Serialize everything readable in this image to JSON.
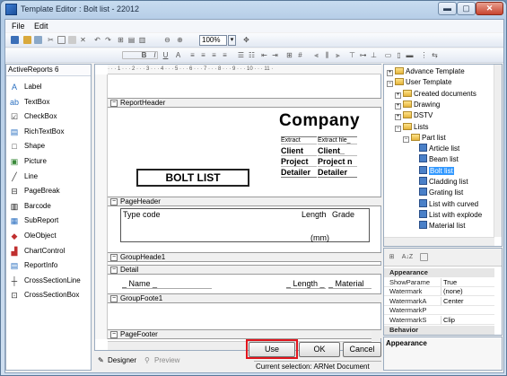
{
  "window": {
    "title": "Template Editor : Bolt list - 22012",
    "min_glyph": "▬",
    "max_glyph": "▢",
    "close_glyph": "✕"
  },
  "menu": {
    "file": "File",
    "edit": "Edit"
  },
  "toolbar": {
    "zoom_value": "100%"
  },
  "toolbox": {
    "header": "ActiveReports 6",
    "items": [
      {
        "label": "Label",
        "icon": "label-icon",
        "glyph": "A",
        "color": "#2a6fc0"
      },
      {
        "label": "TextBox",
        "icon": "textbox-icon",
        "glyph": "ab",
        "color": "#2a6fc0"
      },
      {
        "label": "CheckBox",
        "icon": "checkbox-icon",
        "glyph": "☑",
        "color": "#333333"
      },
      {
        "label": "RichTextBox",
        "icon": "richtextbox-icon",
        "glyph": "▤",
        "color": "#2a6fc0"
      },
      {
        "label": "Shape",
        "icon": "shape-icon",
        "glyph": "□",
        "color": "#333333"
      },
      {
        "label": "Picture",
        "icon": "picture-icon",
        "glyph": "▣",
        "color": "#3a8a3a"
      },
      {
        "label": "Line",
        "icon": "line-icon",
        "glyph": "╱",
        "color": "#333333"
      },
      {
        "label": "PageBreak",
        "icon": "pagebreak-icon",
        "glyph": "⊟",
        "color": "#333333"
      },
      {
        "label": "Barcode",
        "icon": "barcode-icon",
        "glyph": "▥",
        "color": "#000000"
      },
      {
        "label": "SubReport",
        "icon": "subreport-icon",
        "glyph": "▦",
        "color": "#2a6fc0"
      },
      {
        "label": "OleObject",
        "icon": "oleobject-icon",
        "glyph": "◆",
        "color": "#c03030"
      },
      {
        "label": "ChartControl",
        "icon": "chartcontrol-icon",
        "glyph": "▟",
        "color": "#c03030"
      },
      {
        "label": "ReportInfo",
        "icon": "reportinfo-icon",
        "glyph": "▤",
        "color": "#2a6fc0"
      },
      {
        "label": "CrossSectionLine",
        "icon": "crosssectionline-icon",
        "glyph": "┼",
        "color": "#333333"
      },
      {
        "label": "CrossSectionBox",
        "icon": "crosssectionbox-icon",
        "glyph": "⊡",
        "color": "#333333"
      }
    ]
  },
  "designer": {
    "ruler_text": "· · · 1 · · · 2 · · · 3 · · · 4 · · · 5 · · · 6 · · · 7 · · · 8 · · · 9 · · · 10 · · · 11 ·",
    "bands": {
      "report_header": "ReportHeader",
      "page_header": "PageHeader",
      "group_header": "GroupHeade1",
      "detail": "Detail",
      "group_footer": "GroupFoote1",
      "page_footer": "PageFooter"
    },
    "company": "Company",
    "extract_label": "Extract",
    "extract_value": "Extract file_",
    "client_label": "Client",
    "client_value": "Client_",
    "project_label": "Project",
    "project_value": "Project n",
    "detailer_label": "Detailer",
    "detailer_value": "Detailer",
    "title": "BOLT LIST",
    "col_type_code": "Type code",
    "col_length": "Length",
    "col_grade": "Grade",
    "unit_mm": "(mm)",
    "field_name": "_ Name _",
    "field_length": "_ Length _",
    "field_material": "_ Material"
  },
  "tabs": {
    "designer": "Designer",
    "preview": "Preview"
  },
  "buttons": {
    "use": "Use",
    "ok": "OK",
    "cancel": "Cancel"
  },
  "status": {
    "text": "Current selection: ARNet Document"
  },
  "tree": {
    "items": [
      {
        "label": "Advance Template",
        "kind": "folder",
        "level": 0,
        "expander": "+"
      },
      {
        "label": "User Template",
        "kind": "folder",
        "level": 0,
        "expander": "−"
      },
      {
        "label": "Created documents",
        "kind": "folder",
        "level": 1,
        "expander": "+"
      },
      {
        "label": "Drawing",
        "kind": "folder",
        "level": 1,
        "expander": "+"
      },
      {
        "label": "DSTV",
        "kind": "folder",
        "level": 1,
        "expander": "+"
      },
      {
        "label": "Lists",
        "kind": "folder",
        "level": 1,
        "expander": "−"
      },
      {
        "label": "Part list",
        "kind": "folder",
        "level": 2,
        "expander": "−"
      },
      {
        "label": "Article list",
        "kind": "report",
        "level": 3
      },
      {
        "label": "Beam list",
        "kind": "report",
        "level": 3
      },
      {
        "label": "Bolt list",
        "kind": "report",
        "level": 3,
        "selected": true
      },
      {
        "label": "Cladding list",
        "kind": "report",
        "level": 3
      },
      {
        "label": "Grating list",
        "kind": "report",
        "level": 3
      },
      {
        "label": "List with curved",
        "kind": "report",
        "level": 3
      },
      {
        "label": "List with explode",
        "kind": "report",
        "level": 3
      },
      {
        "label": "Material list",
        "kind": "report",
        "level": 3
      }
    ]
  },
  "properties": {
    "sort_glyph": "A↓Z",
    "rows": [
      {
        "name": "Appearance",
        "value": "",
        "category": true
      },
      {
        "name": "ShowParame",
        "value": "True"
      },
      {
        "name": "Watermark",
        "value": "(none)"
      },
      {
        "name": "WatermarkA",
        "value": "Center"
      },
      {
        "name": "WatermarkP",
        "value": ""
      },
      {
        "name": "WatermarkS",
        "value": "Clip"
      },
      {
        "name": "Behavior",
        "value": "",
        "category": true
      }
    ],
    "description_title": "Appearance"
  }
}
